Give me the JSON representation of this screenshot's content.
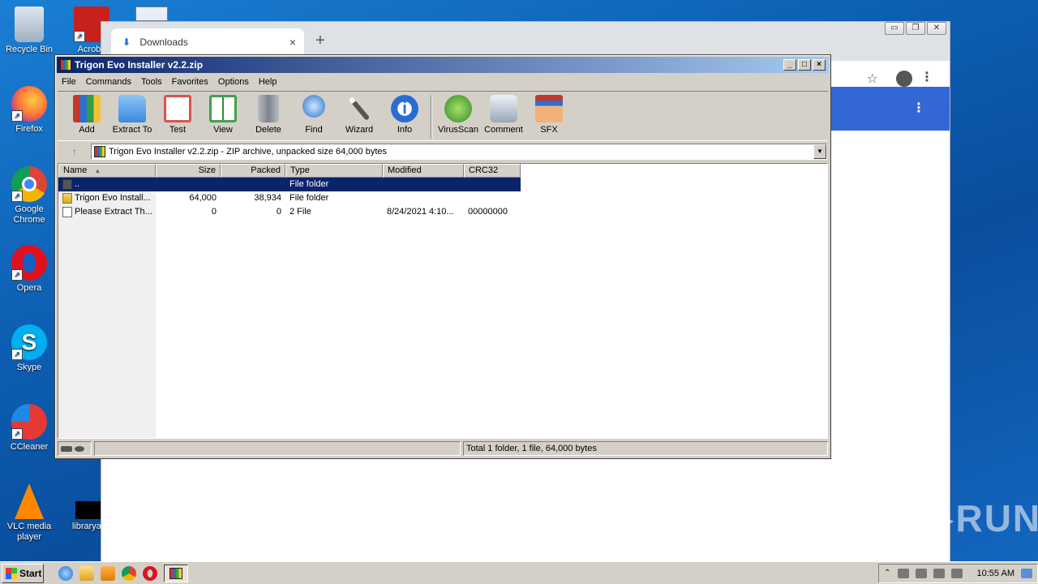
{
  "desktop": {
    "icons": [
      {
        "label": "Recycle Bin"
      },
      {
        "label": "Acroba"
      },
      {
        "label": "Firefox"
      },
      {
        "label": "Google Chrome"
      },
      {
        "label": "Opera"
      },
      {
        "label": "Skype"
      },
      {
        "label": "CCleaner"
      },
      {
        "label": "VLC media player"
      },
      {
        "label": "libraryapp"
      }
    ]
  },
  "chrome": {
    "tab_label": "Downloads",
    "tab_close": "×",
    "new_tab": "+",
    "winctl": [
      "▭",
      "❐",
      "✕"
    ],
    "star": "☆",
    "kebab": "⋮"
  },
  "winrar": {
    "title": "Trigon Evo Installer v2.2.zip",
    "title_controls": [
      "_",
      "□",
      "×"
    ],
    "menu": [
      "File",
      "Commands",
      "Tools",
      "Favorites",
      "Options",
      "Help"
    ],
    "toolbar": [
      {
        "label": "Add",
        "icon": "add-icon",
        "color": "#c0392b"
      },
      {
        "label": "Extract To",
        "icon": "extract-folder-icon",
        "color": "#3a8be0"
      },
      {
        "label": "Test",
        "icon": "test-checklist-icon",
        "color": "#d9534f"
      },
      {
        "label": "View",
        "icon": "view-book-icon",
        "color": "#3fa34d"
      },
      {
        "label": "Delete",
        "icon": "trash-icon",
        "color": "#8a8f99"
      },
      {
        "label": "Find",
        "icon": "magnifier-icon",
        "color": "#2a72c9"
      },
      {
        "label": "Wizard",
        "icon": "magic-wand-icon",
        "color": "#7b7b7b"
      },
      {
        "label": "Info",
        "icon": "info-icon",
        "color": "#2b6cd4"
      }
    ],
    "toolbar2": [
      {
        "label": "VirusScan",
        "icon": "virus-scan-icon",
        "color": "#3ca33c"
      },
      {
        "label": "Comment",
        "icon": "comment-icon",
        "color": "#9aa7b8"
      },
      {
        "label": "SFX",
        "icon": "sfx-box-icon",
        "color": "#e08a3a"
      }
    ],
    "up_arrow": "↑",
    "path": "Trigon Evo Installer v2.2.zip - ZIP archive, unpacked size 64,000 bytes",
    "columns": {
      "name": "Name",
      "sort_arrow": "▲",
      "size": "Size",
      "packed": "Packed",
      "type": "Type",
      "modified": "Modified",
      "crc": "CRC32"
    },
    "rows": [
      {
        "name": "..",
        "size": "",
        "packed": "",
        "type": "File folder",
        "modified": "",
        "crc": ""
      },
      {
        "name": "Trigon Evo Install...",
        "size": "64,000",
        "packed": "38,934",
        "type": "File folder",
        "modified": "",
        "crc": ""
      },
      {
        "name": "Please Extract Th...",
        "size": "0",
        "packed": "0",
        "type": "2 File",
        "modified": "8/24/2021 4:10...",
        "crc": "00000000"
      }
    ],
    "status": "Total 1 folder, 1 file, 64,000 bytes"
  },
  "taskbar": {
    "start": "Start",
    "clock": "10:55 AM"
  },
  "watermark": "ANY▷RUN"
}
